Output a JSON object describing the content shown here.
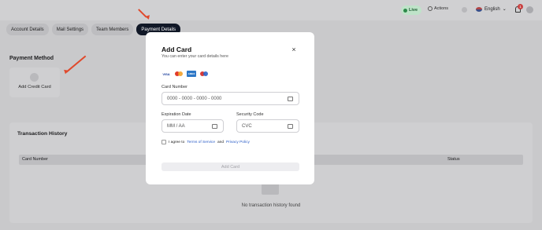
{
  "topbar": {
    "live_label": "Live",
    "actions_label": "Actions",
    "language": "English",
    "notification_count": "1"
  },
  "tabs": [
    {
      "label": "Account Details",
      "active": false
    },
    {
      "label": "Mail Settings",
      "active": false
    },
    {
      "label": "Team Members",
      "active": false
    },
    {
      "label": "Payment Details",
      "active": true
    }
  ],
  "payment": {
    "section_title": "Payment Method",
    "add_card_label": "Add Credit Card"
  },
  "history": {
    "title": "Transaction History",
    "columns": [
      "Card Number",
      "Status"
    ],
    "empty_text": "No transaction history found"
  },
  "modal": {
    "title": "Add Card",
    "subtitle": "You can enter your card details here",
    "card_brands": [
      "VISA",
      "Mastercard",
      "AMEX",
      "Maestro"
    ],
    "card_number": {
      "label": "Card Number",
      "placeholder": "0000 - 0000 - 0000 - 0000"
    },
    "expiration": {
      "label": "Expiration Date",
      "placeholder": "MM / AA"
    },
    "security": {
      "label": "Security Code",
      "placeholder": "CVC"
    },
    "agree": {
      "prefix": "I agree to",
      "terms": "Terms of Service",
      "and": "and",
      "privacy": "Privacy Policy"
    },
    "submit_label": "Add Card"
  },
  "colors": {
    "active_tab": "#111827",
    "annotation_arrow": "#e0492c",
    "link": "#2a5cc7",
    "live": "#2d8a4a"
  }
}
